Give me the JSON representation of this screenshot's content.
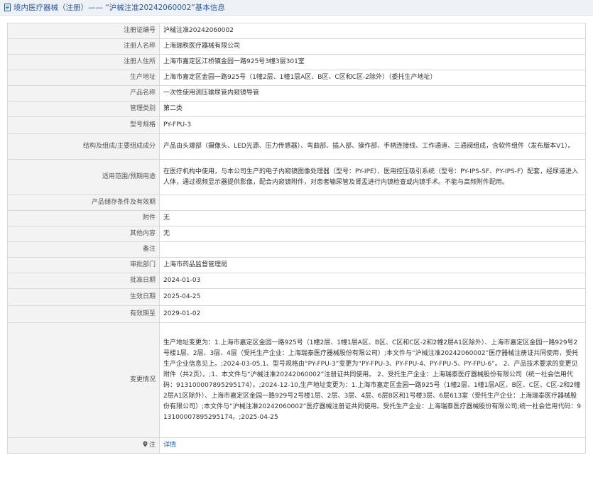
{
  "header": {
    "title": "境内医疗器械（注册）—— “沪械注准20242060002”基本信息"
  },
  "rows": [
    {
      "label": "注册证编号",
      "value": "沪械注准20242060002"
    },
    {
      "label": "注册人名称",
      "value": "上海瑞秩医疗器械有限公司"
    },
    {
      "label": "注册人住所",
      "value": "上海市嘉定区江桥镇金园一路925号3幢3层301室"
    },
    {
      "label": "生产地址",
      "value": "上海市嘉定区金园一路925号（1幢2层、1幢1层A区、B区、C区和C区-2除外）（委托生产地址）"
    },
    {
      "label": "产品名称",
      "value": "一次性使用测压输尿管内窥镜导管"
    },
    {
      "label": "管理类别",
      "value": "第二类"
    },
    {
      "label": "型号规格",
      "value": "PY-FPU-3"
    },
    {
      "label": "结构及组成/主要组成成分",
      "value": "产品由头端部（摄像头、LED光源、压力传感器）、弯曲部、插入部、操作部、手柄连接线、工作通道、三通阀组成，含软件组件（发布版本V1）。"
    },
    {
      "label": "适用范围/预期用途",
      "value": "在医疗机构中使用，与本公司生产的电子内窥镜图像处理器（型号：PY-IPE）、医用控压吸引系统（型号：PY-IPS-SF、PY-IPS-F）配套，经尿道进入人体，通过视频显示器提供影像，配合内窥镜附件，对患者输尿管及肾盂进行内镜检查或内镜手术。不能与高频附件配用。"
    },
    {
      "label": "产品储存条件及有效期",
      "value": ""
    },
    {
      "label": "附件",
      "value": "无"
    },
    {
      "label": "其他内容",
      "value": "无"
    },
    {
      "label": "备注",
      "value": ""
    },
    {
      "label": "审批部门",
      "value": "上海市药品监督管理局"
    },
    {
      "label": "批准日期",
      "value": "2024-01-03"
    },
    {
      "label": "生效日期",
      "value": "2025-04-25"
    },
    {
      "label": "有效期至",
      "value": "2029-01-02"
    },
    {
      "label": "变更情况",
      "value": "生产地址变更为：1.上海市嘉定区金园一路925号（1幢2层、1幢1层A区、B区、C区和C区-2和2幢2层A1区除外）、上海市嘉定区金园一路929号2号楼1层、2层、3层、4层（受托生产企业：上海瑞泰医疗器械股份有限公司）;本文件与“沪械注准20242060002”医疗器械注册证共同使用，受托生产企业信息见上。;2024-03-05,1、型号规格由“PY-FPU-3”变更为“PY-FPU-3、PY-FPU-4、PY-FPU-5、PY-FPU-6”。 2、产品技术要求的变更见附件（共2页）。;1、本文件与“沪械注准20242060002”注册证共同使用。 2、受托生产企业：上海瑞泰医疗器械股份有限公司（统一社会信用代码：91310000789529517­4）。;2024-12-10,生产地址变更为：1.上海市嘉定区金园一路925号（1幢2层、1幢1层A区、B区、C区、C区-2和2幢2层A1区除外）、上海市嘉定区金园一路929号2号楼1层、2层、3层、4层、6层B区和1号楼3层、6层613室（受托生产企业：上海瑞泰医疗器械股份有限公司）;本文件与“沪械注准20242060002”医疗器械注册证共同使用。受托生产企业：上海瑞泰医疗器械股份有限公司;统一社会信用代码：91310000789529517­4。;2025-04-25"
    }
  ],
  "footer": {
    "label": "注",
    "link_text": "详情"
  }
}
